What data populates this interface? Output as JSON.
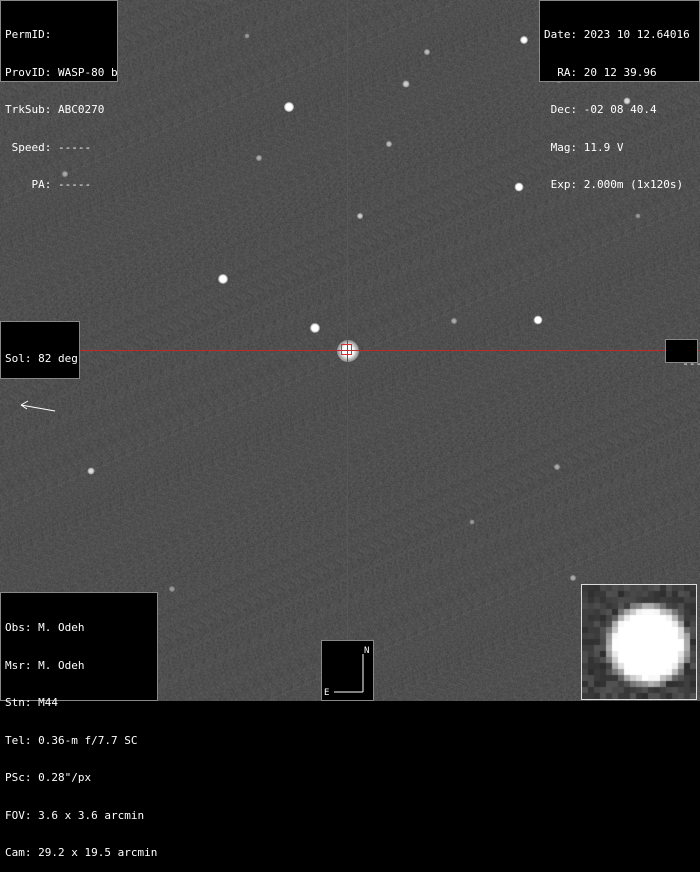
{
  "top_left": {
    "permid": "PermID:",
    "provid": "ProvID: WASP-80 b",
    "trksub": "TrkSub: ABC0270",
    "speed": " Speed: -----",
    "pa": "    PA: -----"
  },
  "top_right": {
    "date": "Date: 2023 10 12.64016",
    "ra": "  RA: 20 12 39.96",
    "dec": " Dec: -02 08 40.4",
    "mag": " Mag: 11.9 V",
    "exp": " Exp: 2.000m (1x120s)"
  },
  "solar": {
    "label": "Sol: 82 deg",
    "arrow_icon": "arrow-left-icon"
  },
  "right_marker": "---",
  "bottom_left": {
    "obs": "Obs: M. Odeh",
    "msr": "Msr: M. Odeh",
    "stn": "Stn: M44",
    "tel": "Tel: 0.36-m f/7.7 SC",
    "psc": "PSc: 0.28\"/px",
    "fov": "FOV: 3.6 x 3.6 arcmin",
    "cam": "Cam: 29.2 x 19.5 arcmin"
  },
  "compass": {
    "north": "N",
    "east": "E"
  },
  "colors": {
    "crosshair": "#c0282d",
    "background": "#4a4a4a",
    "panel": "#000000"
  }
}
